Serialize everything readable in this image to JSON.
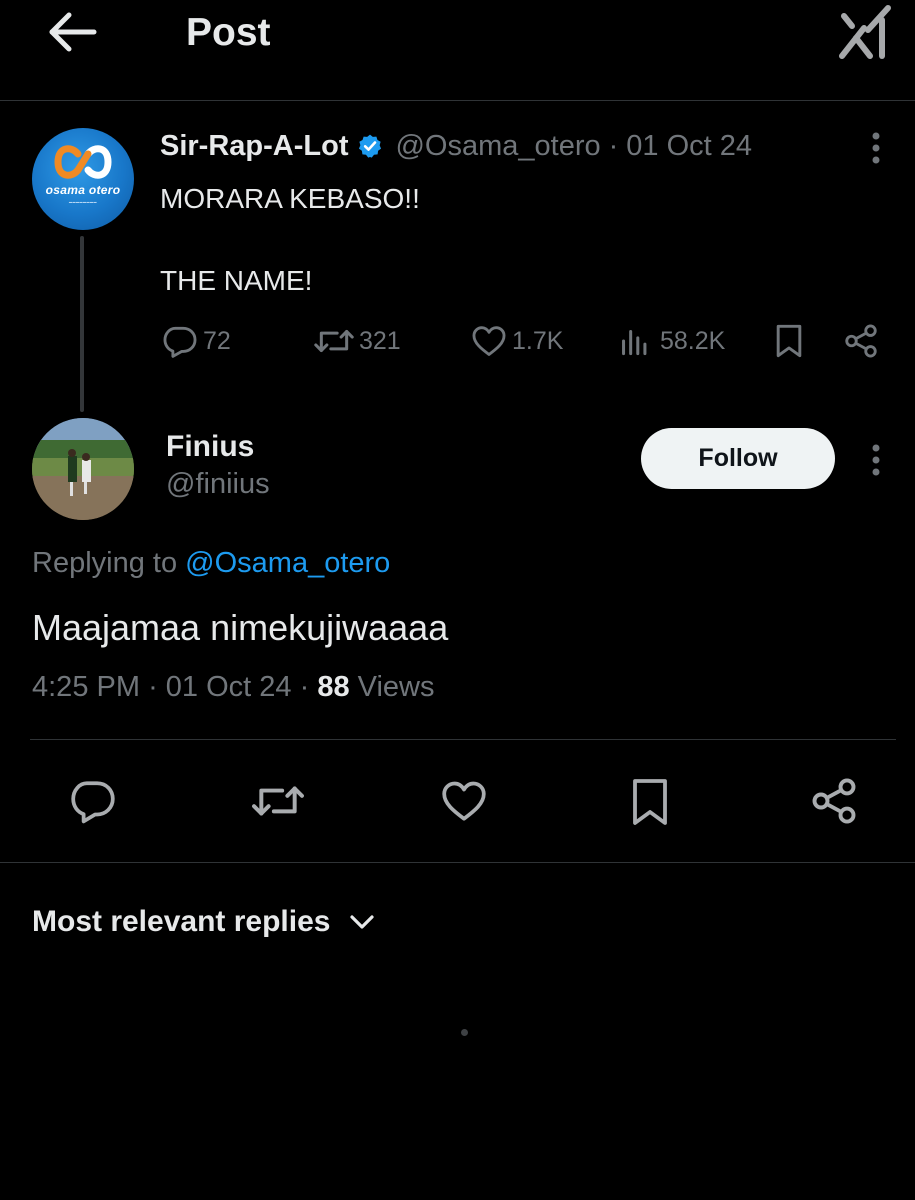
{
  "header": {
    "title": "Post"
  },
  "parent_post": {
    "author_name": "Sir-Rap-A-Lot",
    "handle": "@Osama_otero",
    "separator": "·",
    "date": "01 Oct 24",
    "text": "MORARA KEBASO!!\n\nTHE NAME!",
    "avatar_text": "osama otero",
    "metrics": {
      "replies": "72",
      "reposts": "321",
      "likes": "1.7K",
      "views": "58.2K"
    }
  },
  "reply_post": {
    "author_name": "Finius",
    "handle": "@finiius",
    "follow_label": "Follow",
    "replying_prefix": "Replying to",
    "replying_handle": "@Osama_otero",
    "text": "Maajamaa nimekujiwaaaa",
    "time": "4:25 PM",
    "date": "01 Oct 24",
    "separator": "·",
    "views_count": "88",
    "views_label": "Views"
  },
  "replies_section": {
    "sort_label": "Most relevant replies"
  },
  "colors": {
    "background": "#000000",
    "text": "#e7e9ea",
    "muted": "#71767b",
    "accent": "#1d9bf0",
    "divider": "#2f3336"
  }
}
